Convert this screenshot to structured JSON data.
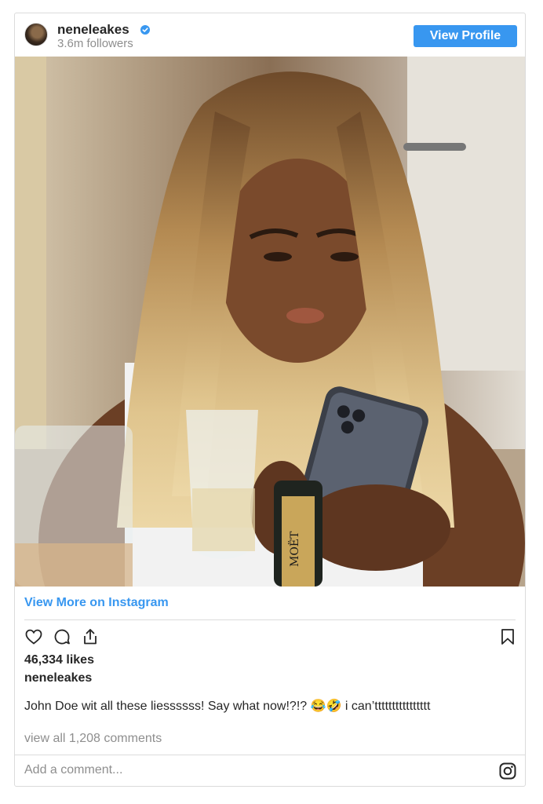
{
  "header": {
    "username": "neneleakes",
    "followers": "3.6m followers",
    "view_profile_label": "View Profile"
  },
  "post": {
    "view_more_label": "View More on Instagram",
    "likes": "46,334 likes",
    "owner": "neneleakes",
    "caption": "John Doe wit all these liessssss! Say what now!?!? 😂🤣 i can’tttttttttttttttt",
    "view_comments": "view all 1,208 comments",
    "bottle_label": "MOËT"
  },
  "comment_box": {
    "placeholder": "Add a comment..."
  },
  "icons": {
    "verified": "verified-badge-icon",
    "like": "heart-icon",
    "comment": "comment-icon",
    "share": "share-icon",
    "save": "bookmark-icon",
    "instagram": "instagram-icon"
  },
  "colors": {
    "accent": "#3897f0",
    "text": "#262626",
    "muted": "#8e8e8e",
    "border": "#dbdbdb"
  }
}
